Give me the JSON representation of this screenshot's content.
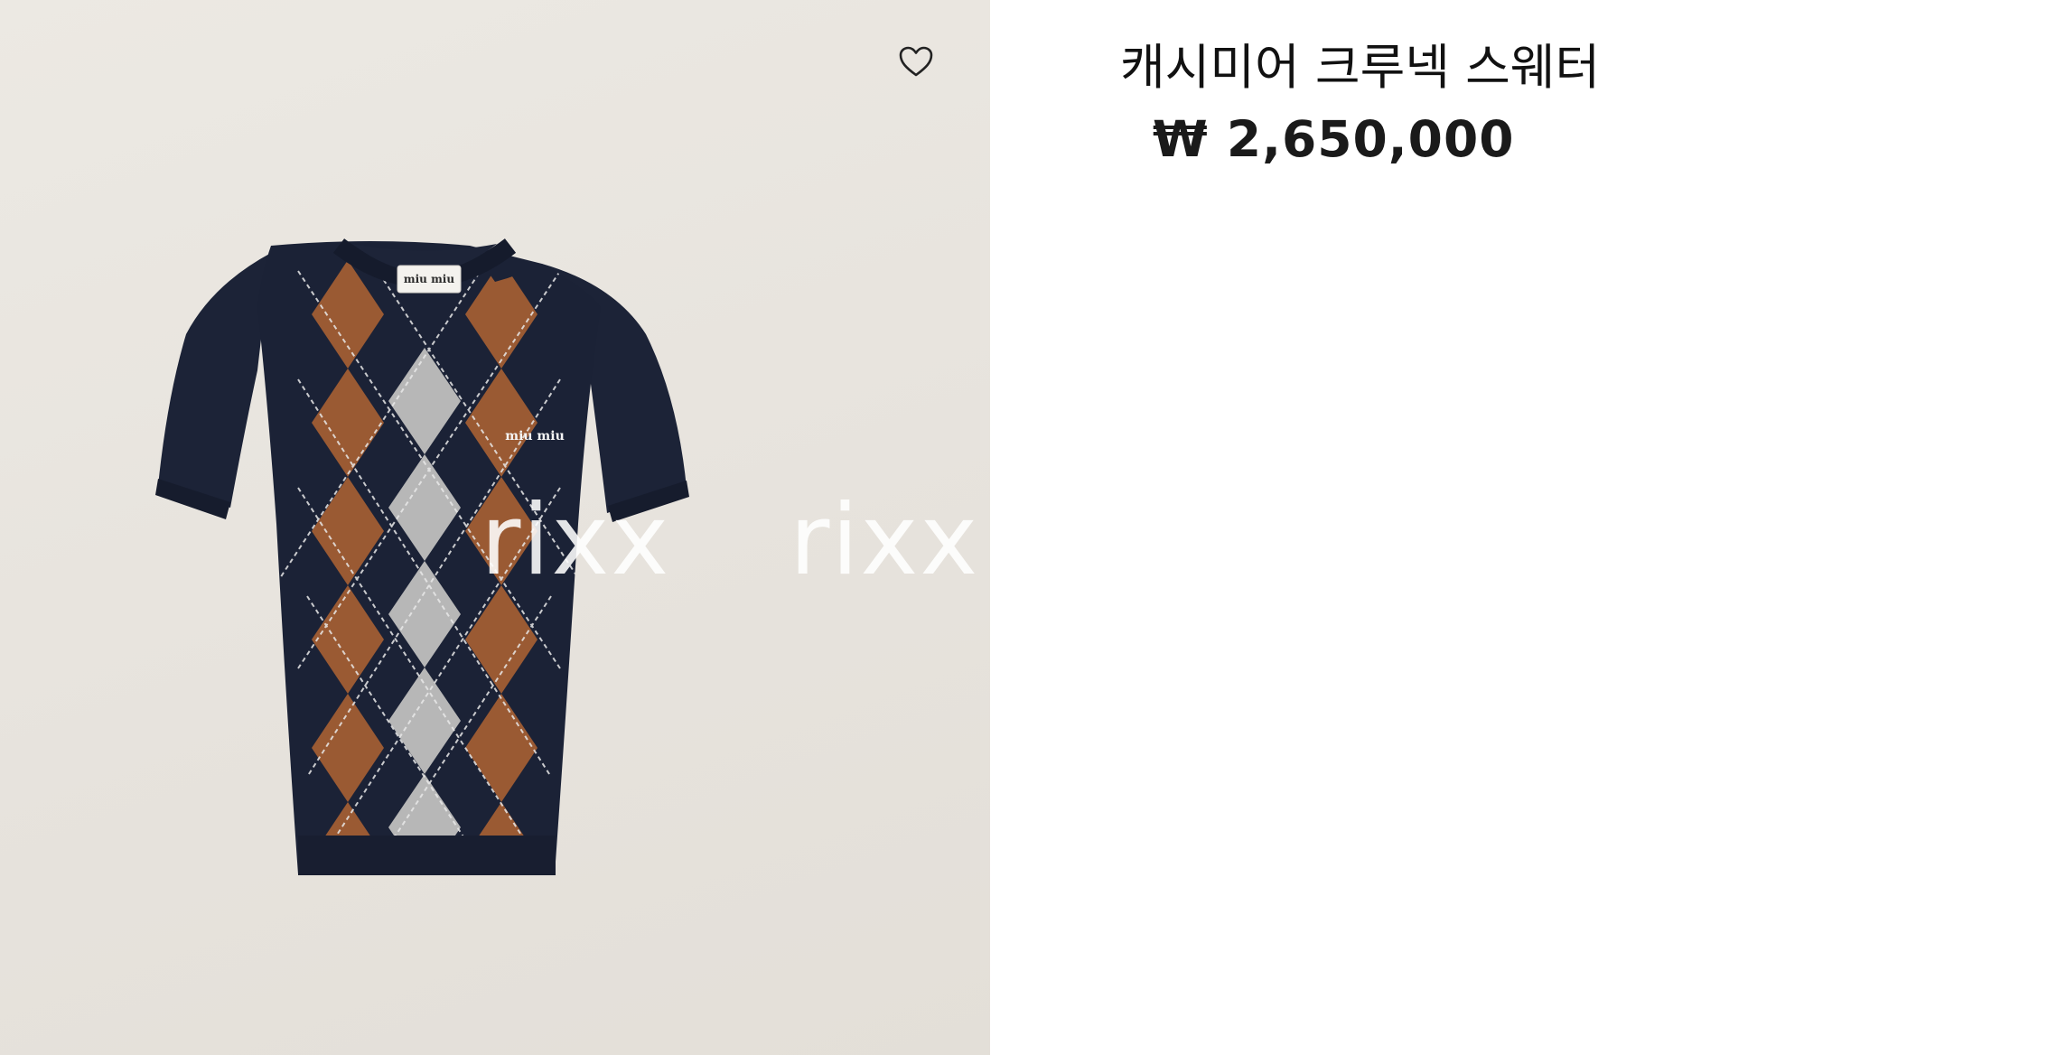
{
  "product": {
    "title": "캐시미어 크루넥 스웨터",
    "price": "₩ 2,650,000",
    "brand_label": "miu miu",
    "chest_logo": "miu miu"
  },
  "watermark": {
    "text_1": "rixx",
    "text_2": "rixx"
  },
  "icons": {
    "wishlist": "heart-outline-icon"
  },
  "colors": {
    "background_left": "#e9e6e0",
    "sweater_navy": "#1b2236",
    "argyle_brown": "#9a5a33",
    "argyle_grey": "#b9b9b9"
  }
}
